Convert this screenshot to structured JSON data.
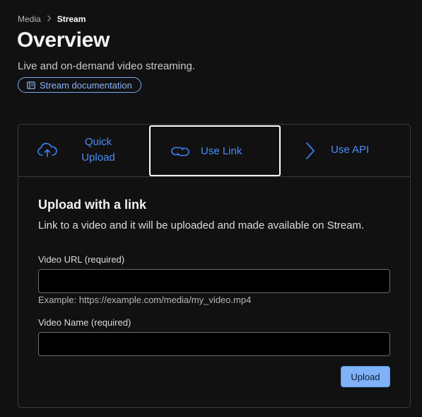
{
  "breadcrumb": {
    "parent": "Media",
    "separator": ">",
    "current": "Stream"
  },
  "header": {
    "title": "Overview",
    "subtitle": "Live and on-demand video streaming.",
    "doc_link": "Stream documentation"
  },
  "tabs": [
    {
      "label_line1": "Quick",
      "label_line2": "Upload",
      "icon": "cloud-upload-icon"
    },
    {
      "label": "Use Link",
      "icon": "link-icon",
      "selected": true
    },
    {
      "label": "Use API",
      "icon": "chevron-right-icon"
    }
  ],
  "upload_form": {
    "title": "Upload with a link",
    "description": "Link to a video and it will be uploaded and made available on Stream.",
    "url_label": "Video URL (required)",
    "url_value": "",
    "url_hint": "Example: https://example.com/media/my_video.mp4",
    "name_label": "Video Name (required)",
    "name_value": "",
    "submit_label": "Upload"
  },
  "colors": {
    "background": "#111111",
    "accent": "#4a8df8",
    "button": "#7fb2f7",
    "border": "#3a3a3a"
  }
}
